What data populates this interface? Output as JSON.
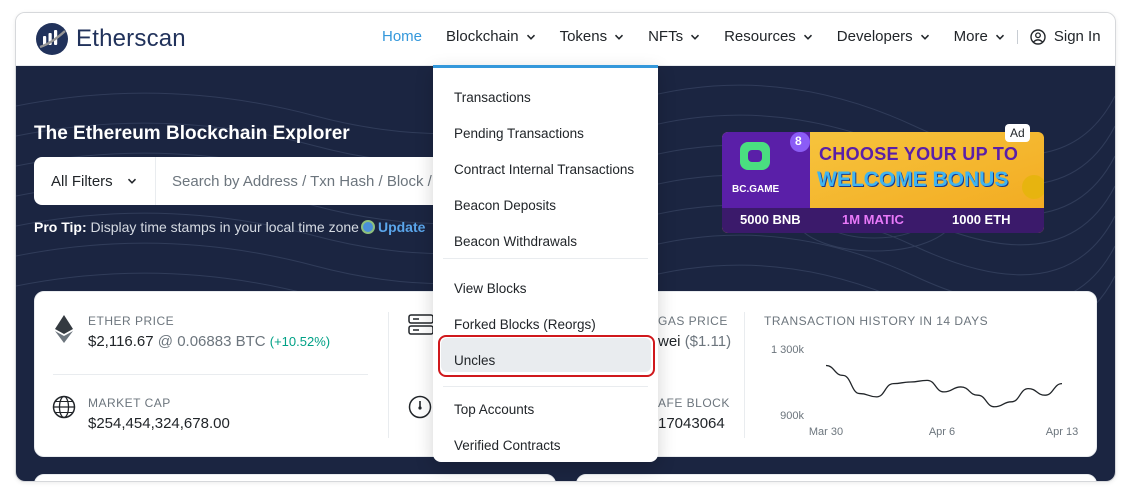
{
  "brand": {
    "name": "Etherscan"
  },
  "nav": {
    "home": "Home",
    "blockchain": "Blockchain",
    "tokens": "Tokens",
    "nfts": "NFTs",
    "resources": "Resources",
    "developers": "Developers",
    "more": "More",
    "sign_in": "Sign In",
    "active": "Home"
  },
  "hero": {
    "title": "The Ethereum Blockchain Explorer",
    "filter_label": "All Filters",
    "search_placeholder": "Search by Address / Txn Hash / Block / Token / Domain Name",
    "protip_label": "Pro Tip:",
    "protip_text": "Display time stamps in your local time zone",
    "protip_link": "Update"
  },
  "ad": {
    "badge": "Ad",
    "brand": "BC.GAME",
    "headline1": "CHOOSE YOUR UP TO",
    "headline2": "WELCOME BONUS",
    "offer1": "5000 BNB",
    "offer2": "1M MATIC",
    "offer3": "1000 ETH",
    "count": "8"
  },
  "stats": {
    "ether_price_label": "ETHER PRICE",
    "ether_price": "$2,116.67",
    "ether_btc": "@ 0.06883 BTC",
    "ether_change": "(+10.52%)",
    "market_cap_label": "MARKET CAP",
    "market_cap": "$254,454,324,678.00",
    "gas_label": "GAS PRICE",
    "gas_value": "wei",
    "gas_usd": "($1.11)",
    "safe_block_label": "AFE BLOCK",
    "safe_block": "17043064"
  },
  "chart_data": {
    "type": "line",
    "title": "TRANSACTION HISTORY IN 14 DAYS",
    "x": [
      "Mar 30",
      "Mar 31",
      "Apr 1",
      "Apr 2",
      "Apr 3",
      "Apr 4",
      "Apr 5",
      "Apr 6",
      "Apr 7",
      "Apr 8",
      "Apr 9",
      "Apr 10",
      "Apr 11",
      "Apr 12",
      "Apr 13"
    ],
    "xticks": [
      "Mar 30",
      "Apr 6",
      "Apr 13"
    ],
    "yticks": [
      "1 300k",
      "900k"
    ],
    "values": [
      1200,
      1140,
      1030,
      1010,
      1090,
      1100,
      1110,
      1040,
      1070,
      1020,
      950,
      980,
      1060,
      1020,
      1090
    ],
    "ylim": [
      900,
      1300
    ],
    "grid": false
  },
  "dropdown": {
    "items": [
      "Transactions",
      "Pending Transactions",
      "Contract Internal Transactions",
      "Beacon Deposits",
      "Beacon Withdrawals",
      "View Blocks",
      "Forked Blocks (Reorgs)",
      "Uncles",
      "Top Accounts",
      "Verified Contracts"
    ],
    "highlighted": "Uncles"
  },
  "colors": {
    "hero_bg": "#1b2541",
    "accent": "#3498db",
    "highlight_ring": "#d0181c",
    "positive": "#00a186"
  }
}
